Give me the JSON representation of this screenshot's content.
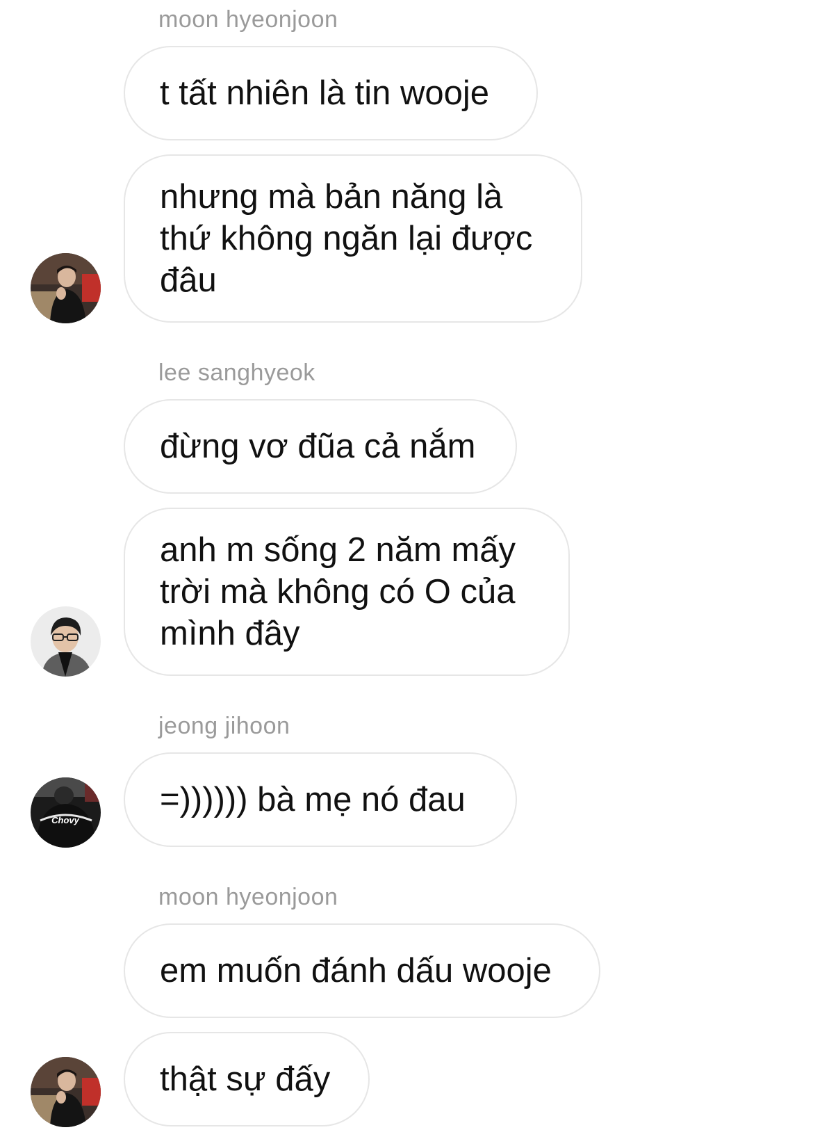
{
  "messages": [
    {
      "sender": "moon hyeonjoon",
      "text": "t tất nhiên là tin wooje"
    },
    {
      "text": "nhưng mà bản năng là\nthứ không ngăn lại được\nđâu"
    },
    {
      "sender": "lee sanghyeok",
      "text": "đừng vơ đũa cả nắm"
    },
    {
      "text": "anh m sống 2 năm mấy\ntrời mà không có O của\nmình đây"
    },
    {
      "sender": "jeong jihoon",
      "text": "=)))))) bà mẹ nó đau"
    },
    {
      "sender": "moon hyeonjoon",
      "text": "em muốn đánh dấu wooje"
    },
    {
      "text": "thật sự đấy"
    }
  ],
  "avatars": [
    {
      "icon": "user-avatar-photo"
    },
    {
      "icon": "user-avatar-photo"
    },
    {
      "icon": "user-avatar-photo"
    },
    {
      "icon": "user-avatar-photo"
    }
  ],
  "jacket_logo": "Chovy",
  "colors": {
    "sender_name": "#9a9a9a",
    "bubble_border": "#e6e6e6",
    "message_text": "#111111",
    "background": "#ffffff"
  }
}
